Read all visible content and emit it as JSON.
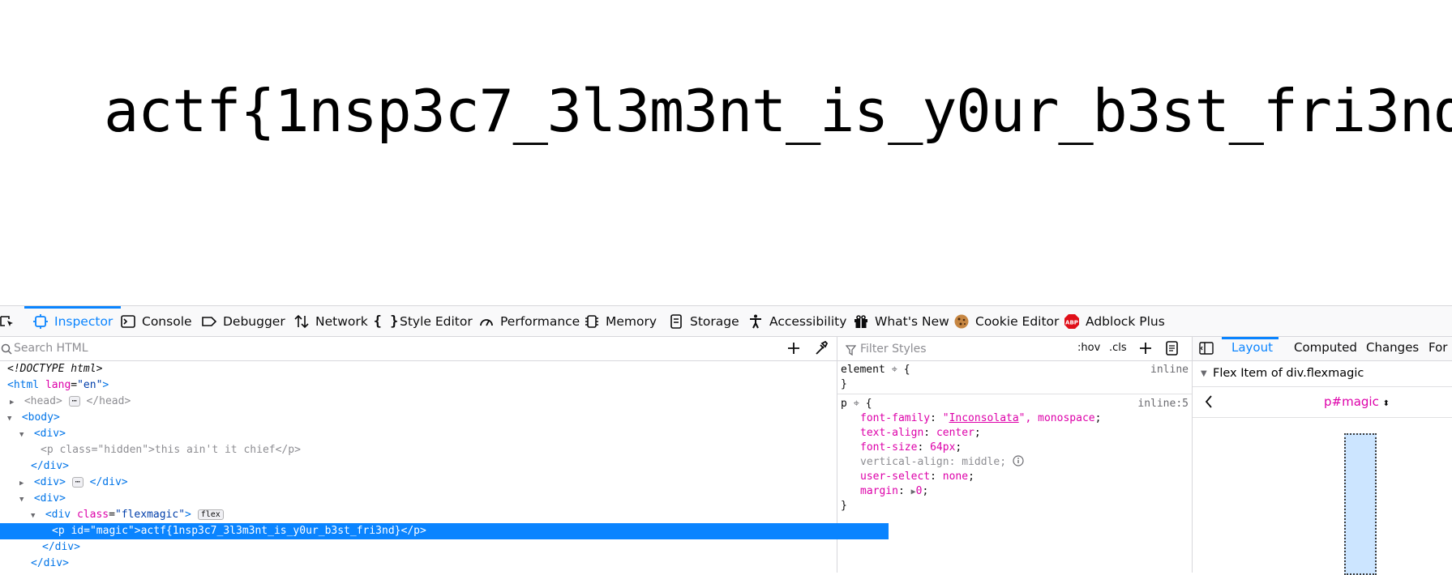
{
  "page": {
    "magic_text": "actf{1nsp3c7_3l3m3nt_is_y0ur_b3st_fri3nd}"
  },
  "toolbar": {
    "tabs": [
      {
        "label": "Inspector",
        "icon": "inspector-icon"
      },
      {
        "label": "Console",
        "icon": "console-icon"
      },
      {
        "label": "Debugger",
        "icon": "debugger-icon"
      },
      {
        "label": "Network",
        "icon": "network-icon"
      },
      {
        "label": "Style Editor",
        "icon": "style-editor-icon"
      },
      {
        "label": "Performance",
        "icon": "performance-icon"
      },
      {
        "label": "Memory",
        "icon": "memory-icon"
      },
      {
        "label": "Storage",
        "icon": "storage-icon"
      },
      {
        "label": "Accessibility",
        "icon": "accessibility-icon"
      },
      {
        "label": "What's New",
        "icon": "gift-icon"
      },
      {
        "label": "Cookie Editor",
        "icon": "cookie-icon"
      },
      {
        "label": "Adblock Plus",
        "icon": "adblock-plus-icon"
      }
    ],
    "selected": "Inspector"
  },
  "markup": {
    "search_placeholder": "Search HTML",
    "lines": {
      "doctype": "<!DOCTYPE html>",
      "html_tag": "html",
      "html_attr": "lang",
      "html_val": "\"en\"",
      "head_tag": "<head>",
      "head_close": "</head>",
      "body_tag": "<body>",
      "div_open": "<div>",
      "div_close": "</div>",
      "hidden_p_open": "<p class=\"hidden\">",
      "hidden_p_text": "this ain't it chief",
      "hidden_p_close": "</p>",
      "flex_div_tag": "div",
      "flex_div_attr": "class",
      "flex_div_val": "\"flexmagic\"",
      "flex_badge": "flex",
      "p_tag": "p",
      "p_attr": "id",
      "p_val": "\"magic\"",
      "p_text": "actf{1nsp3c7_3l3m3nt_is_y0ur_b3st_fri3nd}",
      "p_close": "</p>",
      "ellipsis": "⋯"
    }
  },
  "rules": {
    "filter_placeholder": "Filter Styles",
    "hov": ":hov",
    "cls": ".cls",
    "element_selector": "element",
    "element_source": "inline",
    "p_selector": "p",
    "p_source": "inline:5",
    "declarations": [
      {
        "prop": "font-family",
        "value_link": "Inconsolata",
        "value_rest": ", monospace"
      },
      {
        "prop": "text-align",
        "value": "center"
      },
      {
        "prop": "font-size",
        "value": "64px"
      },
      {
        "prop": "vertical-align",
        "value": "middle",
        "inactive": true
      },
      {
        "prop": "user-select",
        "value": "none"
      },
      {
        "prop": "margin",
        "value": "0"
      }
    ]
  },
  "layout": {
    "tabs": [
      "Layout",
      "Computed",
      "Changes",
      "For"
    ],
    "selected": "Layout",
    "flex_item_title": "Flex Item of div.flexmagic",
    "selector": "p#magic"
  }
}
